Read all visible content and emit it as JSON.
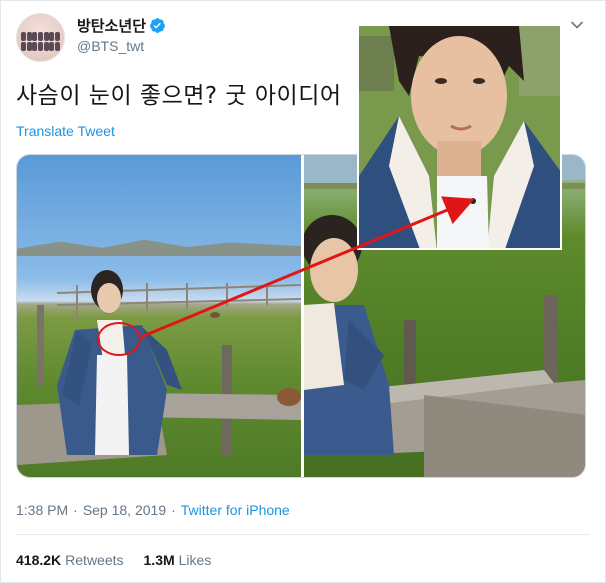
{
  "tweet": {
    "display_name": "방탄소년단",
    "handle": "@BTS_twt",
    "verified": true,
    "text": "사슴이 눈이 좋으면? 굿 아이디어",
    "translate_label": "Translate Tweet",
    "time": "1:38 PM",
    "separator": "·",
    "date": "Sep 18, 2019",
    "source": "Twitter for iPhone",
    "retweets_count": "418.2K",
    "retweets_label": "Retweets",
    "likes_count": "1.3M",
    "likes_label": "Likes"
  },
  "colors": {
    "link": "#1b95e0",
    "secondary_text": "#657786",
    "annotation": "#e01616"
  },
  "icons": {
    "verified": "verified-badge-icon",
    "menu": "chevron-down-icon"
  }
}
